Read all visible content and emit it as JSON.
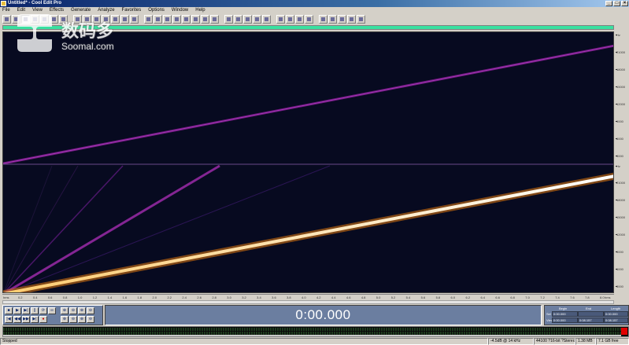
{
  "window": {
    "title": "Untitled* - Cool Edit Pro",
    "controls": [
      "_",
      "□",
      "×"
    ]
  },
  "menu": [
    "File",
    "Edit",
    "View",
    "Effects",
    "Generate",
    "Analyze",
    "Favorites",
    "Options",
    "Window",
    "Help"
  ],
  "toolbar": {
    "button_count": 36
  },
  "waveform": {
    "view": "spectral",
    "channels": 2,
    "background": "#070a20",
    "sweep_colors": {
      "main": "#ffe6a0",
      "harmonic": "#8a1a9a",
      "divider": "#6a4a8a"
    }
  },
  "vertical_scale": [
    "Hz",
    "21000",
    "18000",
    "15000",
    "12000",
    "9000",
    "6000",
    "3000",
    "Hz",
    "21000",
    "18000",
    "15000",
    "12000",
    "9000",
    "6000",
    "3000"
  ],
  "horizontal_ruler": [
    "hms",
    "0.2",
    "0.4",
    "0.6",
    "0.8",
    "1.0",
    "1.2",
    "1.4",
    "1.6",
    "1.8",
    "2.0",
    "2.2",
    "2.4",
    "2.6",
    "2.8",
    "3.0",
    "3.2",
    "3.4",
    "3.6",
    "3.8",
    "4.0",
    "4.2",
    "4.4",
    "4.6",
    "4.8",
    "5.0",
    "5.2",
    "5.4",
    "5.6",
    "5.8",
    "6.0",
    "6.2",
    "6.4",
    "6.6",
    "6.8",
    "7.0",
    "7.2",
    "7.4",
    "7.6",
    "7.8",
    "8.0",
    "hms"
  ],
  "transport": {
    "row1": [
      "■",
      "▶",
      "▶|",
      "||",
      "⟳",
      "∞"
    ],
    "row2": [
      "|◀",
      "◀◀",
      "▶▶",
      "▶|",
      "●"
    ],
    "zoom_row1": [
      "⊕",
      "⊖",
      "⊕",
      "⊖"
    ],
    "zoom_row2": [
      "⊕",
      "⊖",
      "⊕",
      "⊖"
    ]
  },
  "time_display": "0:00.000",
  "selection": {
    "headers": [
      "Begin",
      "End",
      "Length"
    ],
    "rows": [
      {
        "label": "Sel",
        "begin": "0:00.000",
        "end": "",
        "length": "0:00.000"
      },
      {
        "label": "View",
        "begin": "0:00.000",
        "end": "0:08.157",
        "length": "0:08.157"
      }
    ]
  },
  "level_meter": {
    "peak_color": "#e00000"
  },
  "status": {
    "state": "Stopped",
    "left": "-4.5dB @ 14 kHz",
    "sample_format": "44100 ?16-bit ?Stereo",
    "size": "1.38 MB",
    "free": "7.1 GB free"
  },
  "watermark": {
    "cn": "数码多",
    "en": "Soomal.com"
  }
}
